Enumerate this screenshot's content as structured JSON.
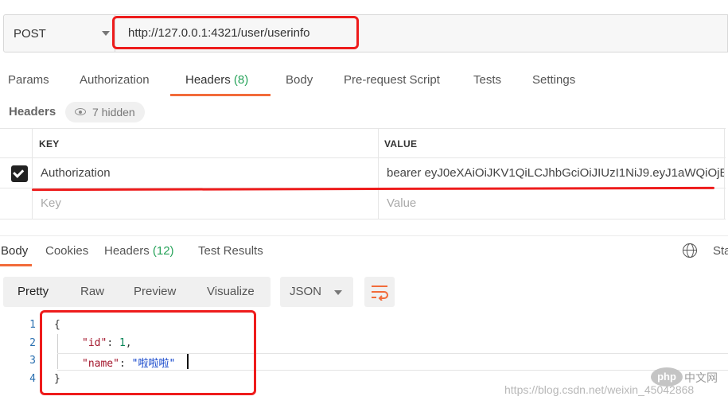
{
  "request": {
    "method": "POST",
    "url": "http://127.0.0.1:4321/user/userinfo"
  },
  "request_tabs": {
    "params": "Params",
    "authorization": "Authorization",
    "headers": "Headers",
    "headers_count": "(8)",
    "body": "Body",
    "prerequest": "Pre-request Script",
    "tests": "Tests",
    "settings": "Settings"
  },
  "headers_section": {
    "title": "Headers",
    "hidden_label": "7 hidden"
  },
  "headers_table": {
    "col_key": "KEY",
    "col_value": "VALUE",
    "rows": [
      {
        "checked": true,
        "key": "Authorization",
        "value": "bearer eyJ0eXAiOiJKV1QiLCJhbGciOiJIUzI1NiJ9.eyJ1aWQiOjE…"
      }
    ],
    "placeholder_key": "Key",
    "placeholder_value": "Value"
  },
  "response_tabs": {
    "body": "Body",
    "cookies": "Cookies",
    "headers": "Headers",
    "headers_count": "(12)",
    "test_results": "Test Results",
    "status_truncated": "Sta"
  },
  "view_modes": {
    "pretty": "Pretty",
    "raw": "Raw",
    "preview": "Preview",
    "visualize": "Visualize",
    "format": "JSON"
  },
  "code": {
    "line_numbers": [
      "1",
      "2",
      "3",
      "4"
    ],
    "open_brace": "{",
    "line2_key": "\"id\"",
    "line2_sep": ": ",
    "line2_val": "1",
    "line2_end": ",",
    "line3_key": "\"name\"",
    "line3_sep": ": ",
    "line3_val": "\"啦啦啦\"",
    "close_brace": "}"
  },
  "watermark": {
    "logo": "php",
    "cn": "中文网",
    "url": "https://blog.csdn.net/weixin_45042868"
  },
  "colors": {
    "accent": "#f26b3a",
    "count_green": "#27a35a",
    "annotation_red": "#ee1c1c"
  }
}
